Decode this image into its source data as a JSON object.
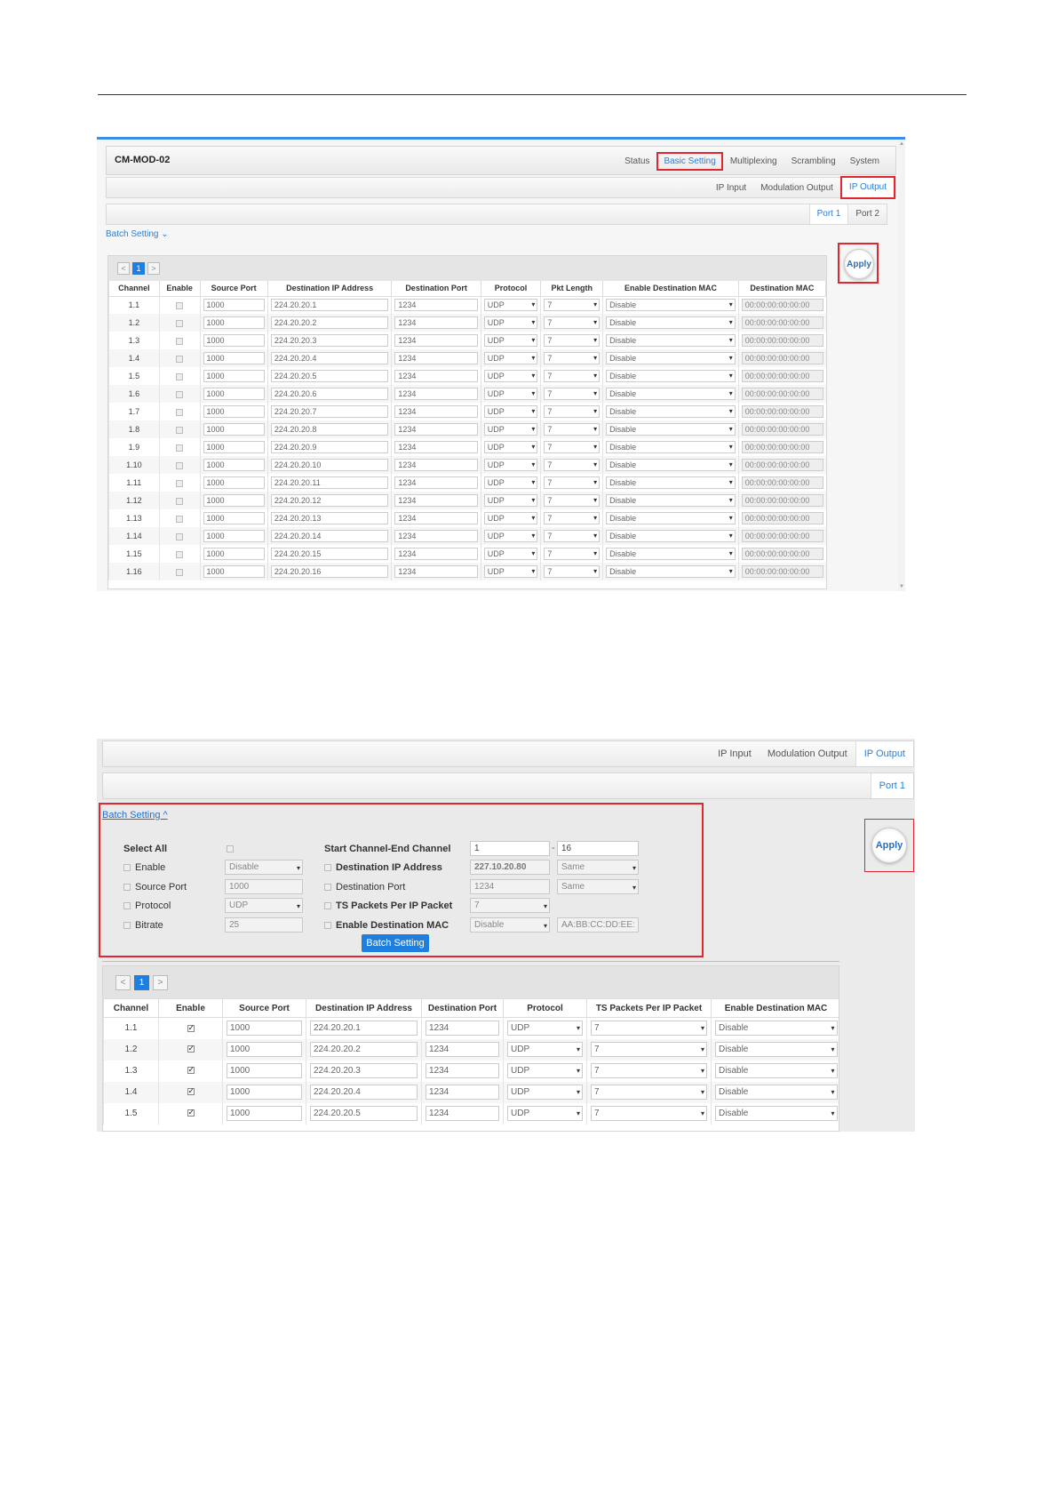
{
  "screen1": {
    "brand": "CM-MOD-02",
    "main_tabs": [
      "Status",
      "Basic Setting",
      "Multiplexing",
      "Scrambling",
      "System"
    ],
    "main_tab_active": 1,
    "sub_tabs": [
      "IP Input",
      "Modulation Output",
      "IP Output"
    ],
    "sub_tab_active": 2,
    "port_tabs": [
      "Port 1",
      "Port 2"
    ],
    "port_tab_active": 0,
    "batch_link": "Batch Setting ⌄",
    "apply_label": "Apply",
    "pager": {
      "prev": "<",
      "page": "1",
      "next": ">"
    },
    "columns": [
      "Channel",
      "Enable",
      "Source Port",
      "Destination IP Address",
      "Destination Port",
      "Protocol",
      "Pkt Length",
      "Enable Destination MAC",
      "Destination MAC"
    ],
    "rows": [
      {
        "channel": "1.1",
        "src": "1000",
        "dip": "224.20.20.1",
        "dport": "1234",
        "proto": "UDP",
        "pkt": "7",
        "emac": "Disable",
        "mac": "00:00:00:00:00:00"
      },
      {
        "channel": "1.2",
        "src": "1000",
        "dip": "224.20.20.2",
        "dport": "1234",
        "proto": "UDP",
        "pkt": "7",
        "emac": "Disable",
        "mac": "00:00:00:00:00:00"
      },
      {
        "channel": "1.3",
        "src": "1000",
        "dip": "224.20.20.3",
        "dport": "1234",
        "proto": "UDP",
        "pkt": "7",
        "emac": "Disable",
        "mac": "00:00:00:00:00:00"
      },
      {
        "channel": "1.4",
        "src": "1000",
        "dip": "224.20.20.4",
        "dport": "1234",
        "proto": "UDP",
        "pkt": "7",
        "emac": "Disable",
        "mac": "00:00:00:00:00:00"
      },
      {
        "channel": "1.5",
        "src": "1000",
        "dip": "224.20.20.5",
        "dport": "1234",
        "proto": "UDP",
        "pkt": "7",
        "emac": "Disable",
        "mac": "00:00:00:00:00:00"
      },
      {
        "channel": "1.6",
        "src": "1000",
        "dip": "224.20.20.6",
        "dport": "1234",
        "proto": "UDP",
        "pkt": "7",
        "emac": "Disable",
        "mac": "00:00:00:00:00:00"
      },
      {
        "channel": "1.7",
        "src": "1000",
        "dip": "224.20.20.7",
        "dport": "1234",
        "proto": "UDP",
        "pkt": "7",
        "emac": "Disable",
        "mac": "00:00:00:00:00:00"
      },
      {
        "channel": "1.8",
        "src": "1000",
        "dip": "224.20.20.8",
        "dport": "1234",
        "proto": "UDP",
        "pkt": "7",
        "emac": "Disable",
        "mac": "00:00:00:00:00:00"
      },
      {
        "channel": "1.9",
        "src": "1000",
        "dip": "224.20.20.9",
        "dport": "1234",
        "proto": "UDP",
        "pkt": "7",
        "emac": "Disable",
        "mac": "00:00:00:00:00:00"
      },
      {
        "channel": "1.10",
        "src": "1000",
        "dip": "224.20.20.10",
        "dport": "1234",
        "proto": "UDP",
        "pkt": "7",
        "emac": "Disable",
        "mac": "00:00:00:00:00:00"
      },
      {
        "channel": "1.11",
        "src": "1000",
        "dip": "224.20.20.11",
        "dport": "1234",
        "proto": "UDP",
        "pkt": "7",
        "emac": "Disable",
        "mac": "00:00:00:00:00:00"
      },
      {
        "channel": "1.12",
        "src": "1000",
        "dip": "224.20.20.12",
        "dport": "1234",
        "proto": "UDP",
        "pkt": "7",
        "emac": "Disable",
        "mac": "00:00:00:00:00:00"
      },
      {
        "channel": "1.13",
        "src": "1000",
        "dip": "224.20.20.13",
        "dport": "1234",
        "proto": "UDP",
        "pkt": "7",
        "emac": "Disable",
        "mac": "00:00:00:00:00:00"
      },
      {
        "channel": "1.14",
        "src": "1000",
        "dip": "224.20.20.14",
        "dport": "1234",
        "proto": "UDP",
        "pkt": "7",
        "emac": "Disable",
        "mac": "00:00:00:00:00:00"
      },
      {
        "channel": "1.15",
        "src": "1000",
        "dip": "224.20.20.15",
        "dport": "1234",
        "proto": "UDP",
        "pkt": "7",
        "emac": "Disable",
        "mac": "00:00:00:00:00:00"
      },
      {
        "channel": "1.16",
        "src": "1000",
        "dip": "224.20.20.16",
        "dport": "1234",
        "proto": "UDP",
        "pkt": "7",
        "emac": "Disable",
        "mac": "00:00:00:00:00:00"
      }
    ]
  },
  "screen2": {
    "sub_tabs": [
      "IP Input",
      "Modulation Output",
      "IP Output"
    ],
    "sub_tab_active": 2,
    "port_tabs": [
      "Port 1"
    ],
    "batch_link": "Batch Setting ^",
    "apply_label": "Apply",
    "batch": {
      "select_all": "Select All",
      "enable": "Enable",
      "enable_value": "Disable",
      "source_port": "Source Port",
      "source_port_value": "1000",
      "protocol": "Protocol",
      "protocol_value": "UDP",
      "bitrate": "Bitrate",
      "bitrate_value": "25",
      "start_end": "Start Channel-End Channel",
      "start_value": "1",
      "range_dash": "-",
      "end_value": "16",
      "dest_ip": "Destination IP Address",
      "dest_ip_value": "227.10.20.80",
      "dest_ip_mode": "Same",
      "dest_port": "Destination Port",
      "dest_port_value": "1234",
      "dest_port_mode": "Same",
      "ts_packets": "TS Packets Per IP Packet",
      "ts_packets_value": "7",
      "enable_mac": "Enable Destination MAC",
      "enable_mac_value": "Disable",
      "mac_value": "AA:BB:CC:DD:EE:",
      "button": "Batch Setting"
    },
    "pager": {
      "prev": "<",
      "page": "1",
      "next": ">"
    },
    "columns": [
      "Channel",
      "Enable",
      "Source Port",
      "Destination IP Address",
      "Destination Port",
      "Protocol",
      "TS Packets Per IP Packet",
      "Enable Destination MAC"
    ],
    "rows": [
      {
        "channel": "1.1",
        "src": "1000",
        "dip": "224.20.20.1",
        "dport": "1234",
        "proto": "UDP",
        "pkt": "7",
        "emac": "Disable"
      },
      {
        "channel": "1.2",
        "src": "1000",
        "dip": "224.20.20.2",
        "dport": "1234",
        "proto": "UDP",
        "pkt": "7",
        "emac": "Disable"
      },
      {
        "channel": "1.3",
        "src": "1000",
        "dip": "224.20.20.3",
        "dport": "1234",
        "proto": "UDP",
        "pkt": "7",
        "emac": "Disable"
      },
      {
        "channel": "1.4",
        "src": "1000",
        "dip": "224.20.20.4",
        "dport": "1234",
        "proto": "UDP",
        "pkt": "7",
        "emac": "Disable"
      },
      {
        "channel": "1.5",
        "src": "1000",
        "dip": "224.20.20.5",
        "dport": "1234",
        "proto": "UDP",
        "pkt": "7",
        "emac": "Disable"
      }
    ]
  },
  "colors": {
    "accent": "#1f7fde",
    "highlight": "#e0262f",
    "top_bar": "#3a8ee6"
  }
}
